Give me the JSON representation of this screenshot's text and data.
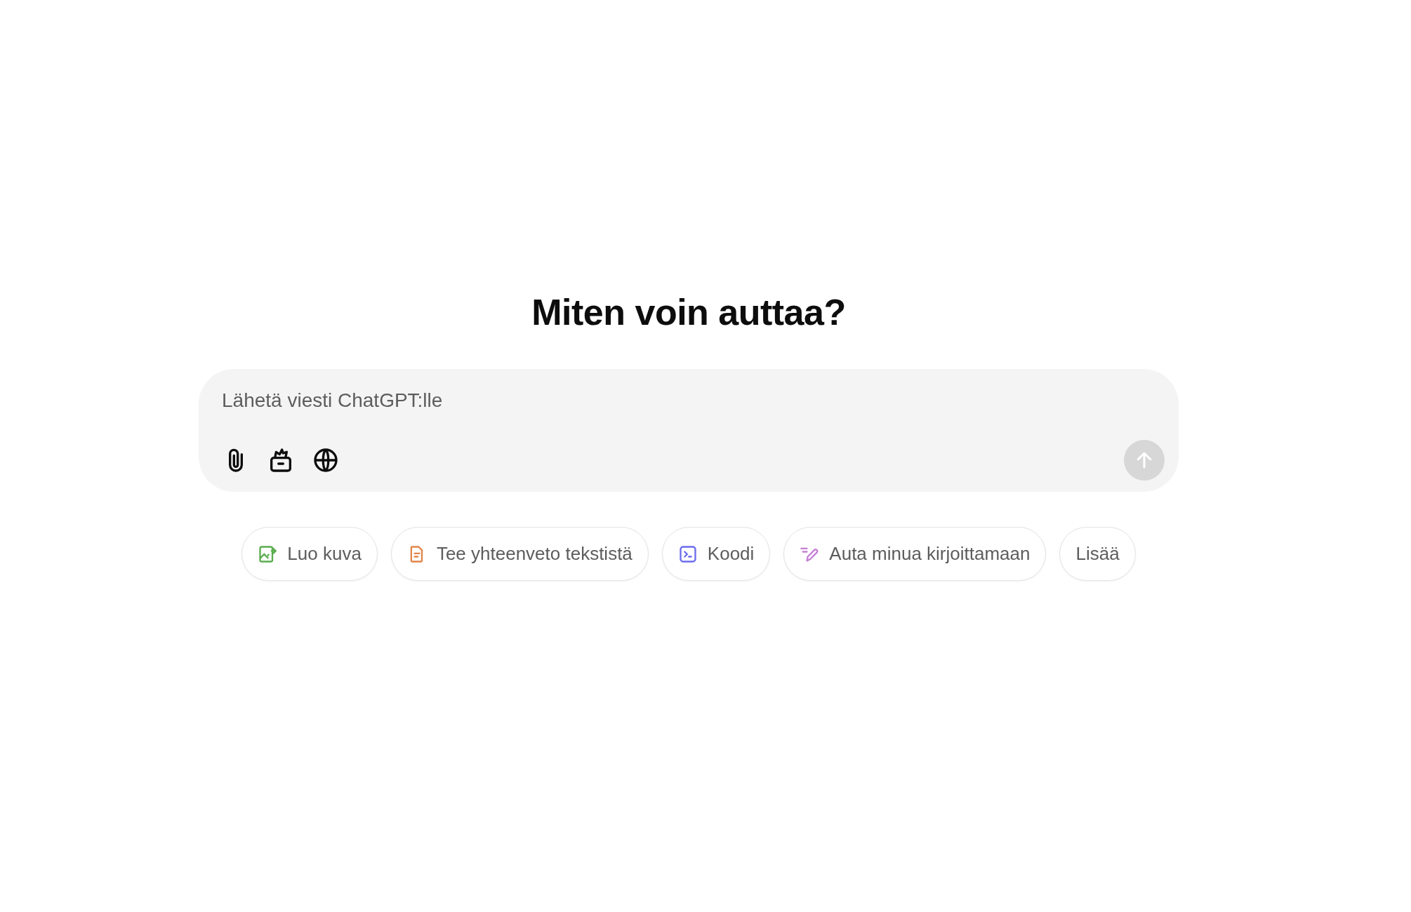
{
  "heading": "Miten voin auttaa?",
  "composer": {
    "placeholder": "Lähetä viesti ChatGPT:lle",
    "tools": [
      {
        "kind": "attach"
      },
      {
        "kind": "toolbox"
      },
      {
        "kind": "globe"
      }
    ],
    "send_disabled": true
  },
  "suggestions": [
    {
      "label": "Luo kuva",
      "kind": "image",
      "color": "#5aad4e"
    },
    {
      "label": "Tee yhteenveto tekstistä",
      "kind": "document",
      "color": "#e2854a"
    },
    {
      "label": "Koodi",
      "kind": "code",
      "color": "#6b6cf0"
    },
    {
      "label": "Auta minua kirjoittamaan",
      "kind": "pen",
      "color": "#c57ed4"
    },
    {
      "label": "Lisää",
      "kind": "more"
    }
  ]
}
